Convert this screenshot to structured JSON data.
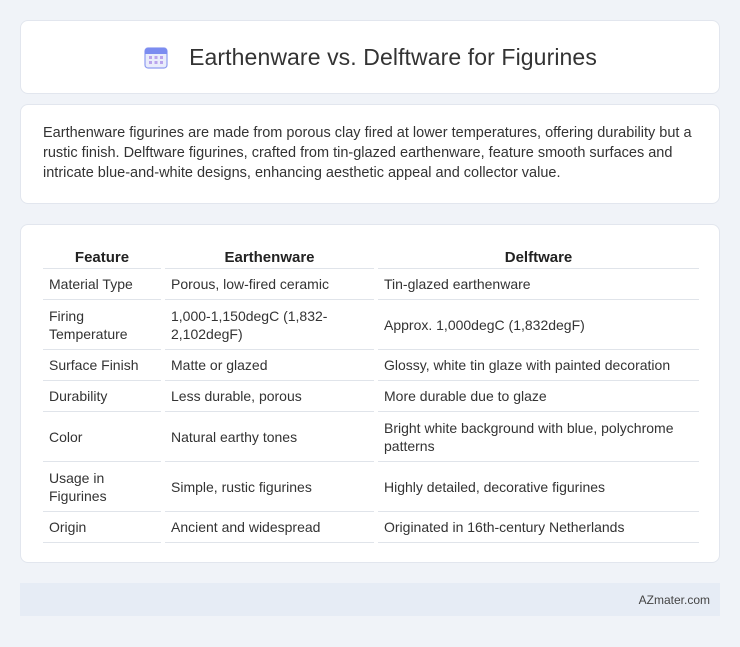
{
  "header": {
    "title": "Earthenware vs. Delftware for Figurines",
    "icon": "calendar-icon",
    "icon_color": "#7b8cf0"
  },
  "intro": {
    "text": "Earthenware figurines are made from porous clay fired at lower temperatures, offering durability but a rustic finish. Delftware figurines, crafted from tin-glazed earthenware, feature smooth surfaces and intricate blue-and-white designs, enhancing aesthetic appeal and collector value."
  },
  "table": {
    "headers": [
      "Feature",
      "Earthenware",
      "Delftware"
    ],
    "rows": [
      [
        "Material Type",
        "Porous, low-fired ceramic",
        "Tin-glazed earthenware"
      ],
      [
        "Firing Temperature",
        "1,000-1,150degC (1,832-2,102degF)",
        "Approx. 1,000degC (1,832degF)"
      ],
      [
        "Surface Finish",
        "Matte or glazed",
        "Glossy, white tin glaze with painted decoration"
      ],
      [
        "Durability",
        "Less durable, porous",
        "More durable due to glaze"
      ],
      [
        "Color",
        "Natural earthy tones",
        "Bright white background with blue, polychrome patterns"
      ],
      [
        "Usage in Figurines",
        "Simple, rustic figurines",
        "Highly detailed, decorative figurines"
      ],
      [
        "Origin",
        "Ancient and widespread",
        "Originated in 16th-century Netherlands"
      ]
    ]
  },
  "footer": {
    "source": "AZmater.com"
  }
}
